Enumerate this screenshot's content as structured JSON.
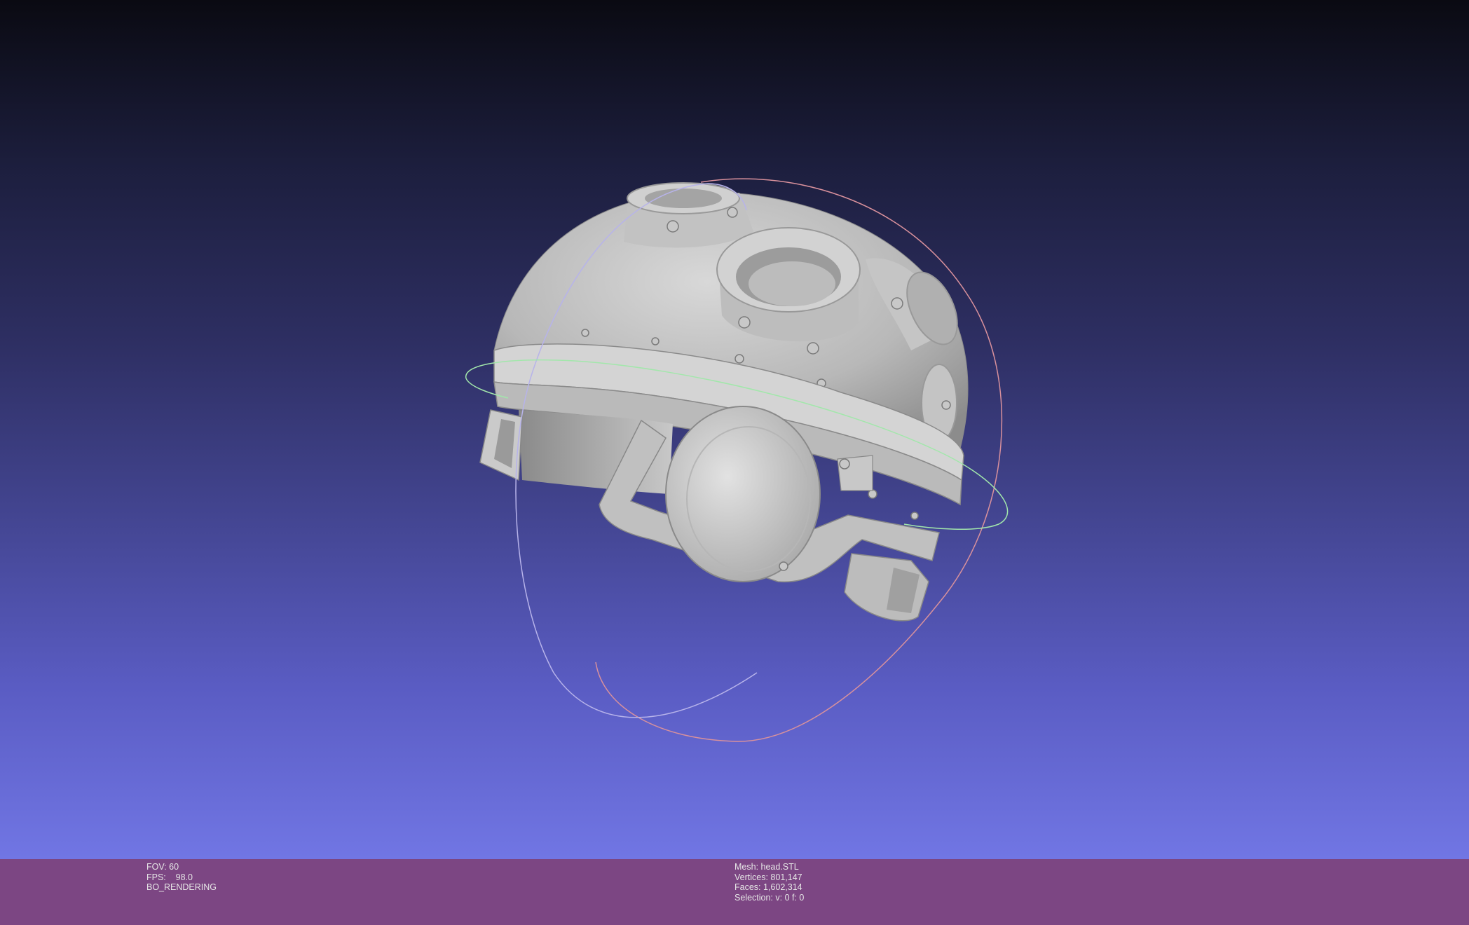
{
  "viewport": {
    "model": "helmet-mesh",
    "gizmo": "trackball"
  },
  "status": {
    "left": {
      "fov": "FOV: 60",
      "fps": "FPS:    98.0",
      "mode": "BO_RENDERING"
    },
    "right": {
      "mesh": "Mesh: head.STL",
      "vertices": "Vertices: 801,147",
      "faces": "Faces: 1,602,314",
      "selection": "Selection: v: 0 f: 0"
    }
  },
  "colors": {
    "status_bar": "#7c4683",
    "gradient_top": "#0a0a12",
    "gradient_bottom": "#7176e4"
  }
}
